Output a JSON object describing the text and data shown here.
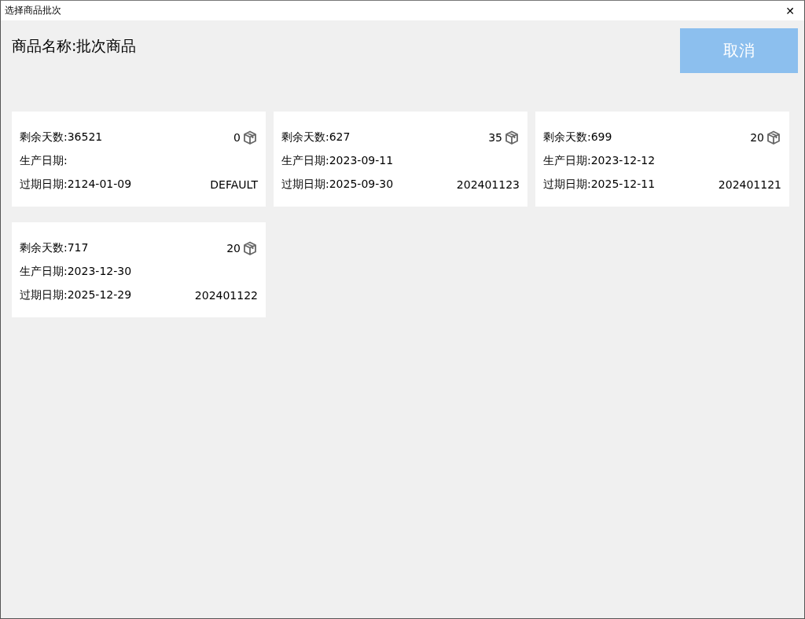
{
  "window": {
    "title": "选择商品批次",
    "close": "✕"
  },
  "header": {
    "product_name": "商品名称:批次商品",
    "cancel_button": "取消"
  },
  "batches": [
    {
      "remaining_days": "剩余天数:36521",
      "quantity": "0",
      "production_date": "生产日期:",
      "expiry_date": "过期日期:2124-01-09",
      "batch_no": "DEFAULT"
    },
    {
      "remaining_days": "剩余天数:627",
      "quantity": "35",
      "production_date": "生产日期:2023-09-11",
      "expiry_date": "过期日期:2025-09-30",
      "batch_no": "202401123"
    },
    {
      "remaining_days": "剩余天数:699",
      "quantity": "20",
      "production_date": "生产日期:2023-12-12",
      "expiry_date": "过期日期:2025-12-11",
      "batch_no": "202401121"
    },
    {
      "remaining_days": "剩余天数:717",
      "quantity": "20",
      "production_date": "生产日期:2023-12-30",
      "expiry_date": "过期日期:2025-12-29",
      "batch_no": "202401122"
    }
  ]
}
